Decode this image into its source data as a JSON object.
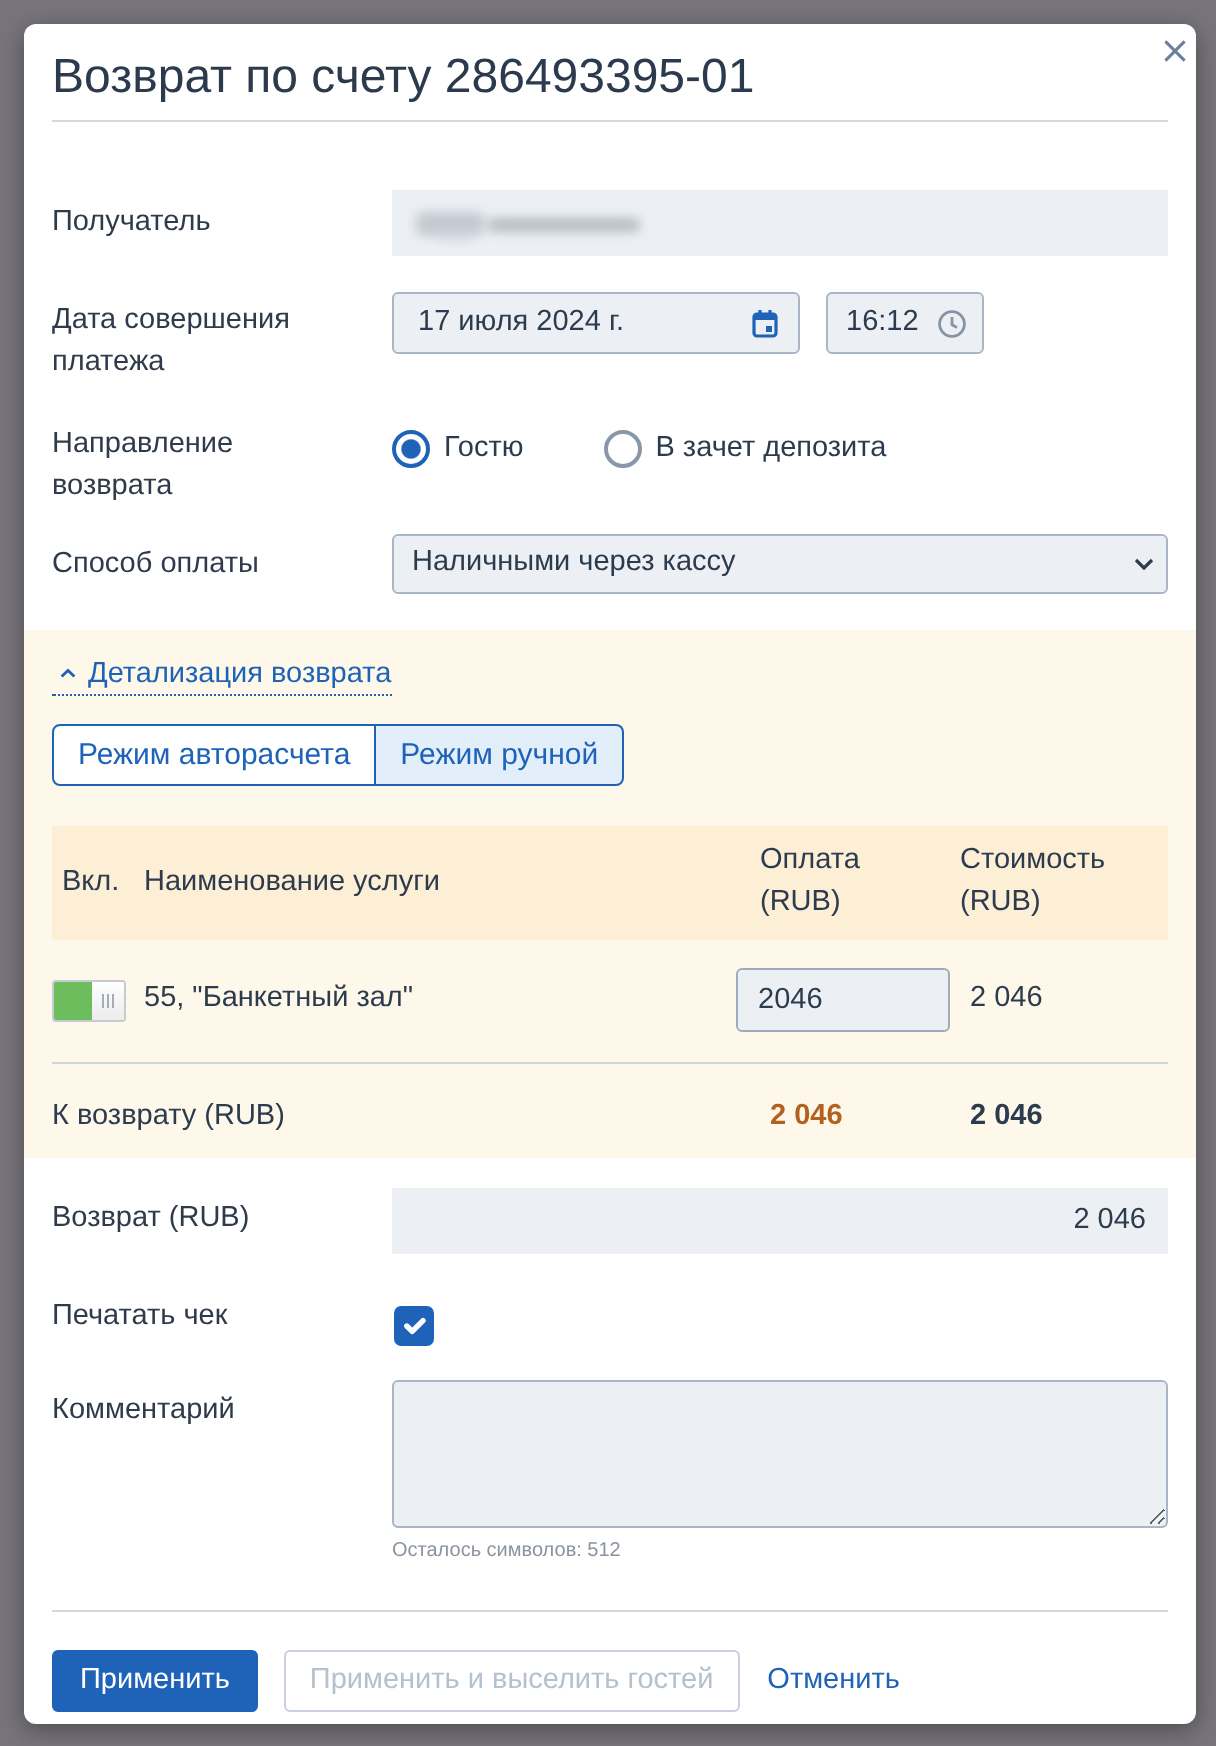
{
  "dialog": {
    "title": "Возврат по счету 286493395-01"
  },
  "recipient": {
    "label": "Получатель"
  },
  "payment_date": {
    "label": "Дата совершения платежа",
    "date": "17 июля 2024 г.",
    "time": "16:12"
  },
  "refund_direction": {
    "label": "Направление возврата",
    "options": [
      {
        "label": "Гостю",
        "selected": true
      },
      {
        "label": "В зачет депозита",
        "selected": false
      }
    ]
  },
  "payment_method": {
    "label": "Способ оплаты",
    "value": "Наличными через кассу"
  },
  "details": {
    "toggle": "Детализация возврата",
    "expanded": true,
    "modes": [
      {
        "label": "Режим авторасчета",
        "selected": false
      },
      {
        "label": "Режим ручной",
        "selected": true
      }
    ],
    "table": {
      "columns": [
        "Вкл.",
        "Наименование услуги",
        "Оплата (RUB)",
        "Стоимость (RUB)"
      ],
      "rows": [
        {
          "on": true,
          "service": "55, \"Банкетный зал\"",
          "payment": "2046",
          "cost": "2 046"
        }
      ],
      "total": {
        "label": "К возврату (RUB)",
        "payment": "2 046",
        "cost": "2 046"
      }
    }
  },
  "refund": {
    "label": "Возврат (RUB)",
    "value": "2 046"
  },
  "print_receipt": {
    "label": "Печатать чек",
    "checked": true
  },
  "comment": {
    "label": "Комментарий",
    "hint": "Осталось символов: 512"
  },
  "buttons": [
    {
      "label": "Применить",
      "kind": "primary",
      "disabled": false
    },
    {
      "label": "Применить и выселить гостей",
      "kind": "outline",
      "disabled": true
    },
    {
      "label": "Отменить",
      "kind": "link",
      "disabled": false
    }
  ]
}
